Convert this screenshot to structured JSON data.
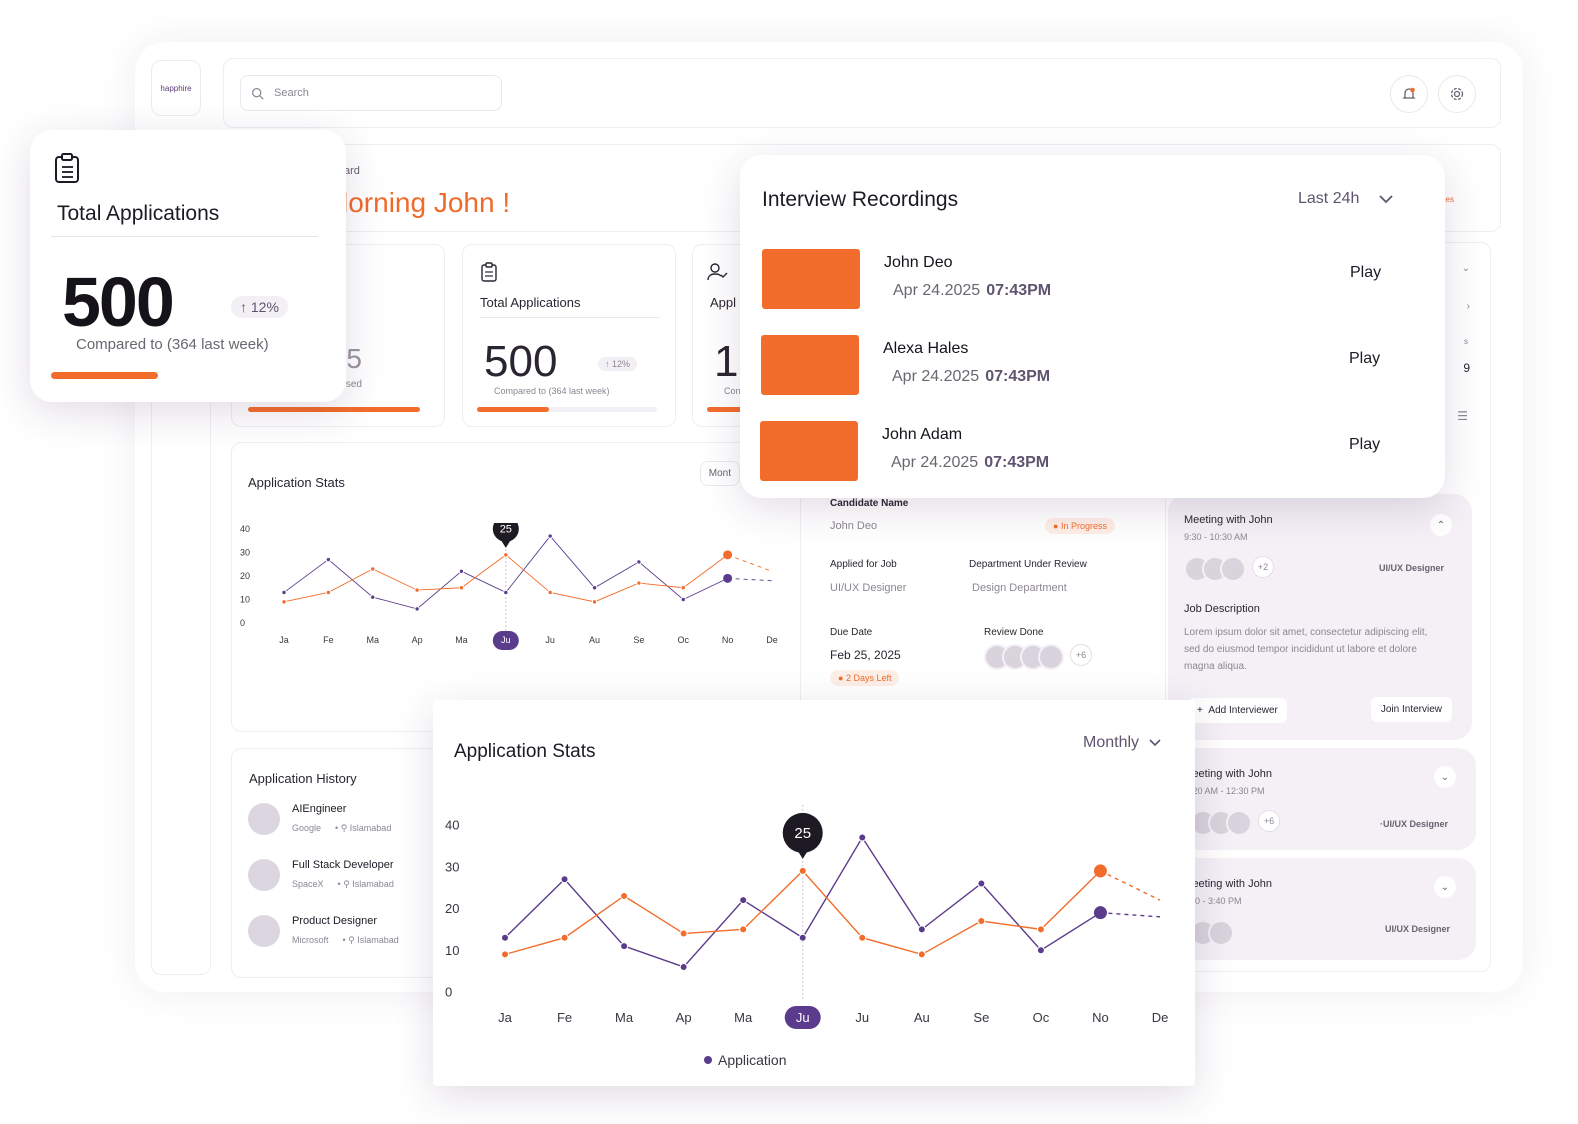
{
  "brand": {
    "logo": "happhire",
    "accent": "#f26d2b",
    "purple": "#5a3b8c"
  },
  "topbar": {
    "search_placeholder": "Search",
    "bell_icon": "bell-icon",
    "settings_icon": "gear-icon"
  },
  "greeting": {
    "breadcrumb": "ard",
    "message": "lorning John !",
    "right_text": "es"
  },
  "stat_cards": [
    {
      "label": "",
      "value": "5",
      "note": "sed"
    },
    {
      "label": "Total Applications",
      "value": "500",
      "change": "12%",
      "note": "Compared to (364 last week)",
      "progress": 0.4
    },
    {
      "label": "Appl",
      "value": "15",
      "note": "Con"
    }
  ],
  "total_card": {
    "title": "Total Applications",
    "value": "500",
    "change": "12%",
    "note": "Compared to (364 last week)",
    "progress": 0.4
  },
  "interview_recordings": {
    "title": "Interview Recordings",
    "filter": "Last 24h",
    "items": [
      {
        "name": "John Deo",
        "date": "Apr 24.2025",
        "time": "07:43PM",
        "action": "Play"
      },
      {
        "name": "Alexa Hales",
        "date": "Apr 24.2025",
        "time": "07:43PM",
        "action": "Play"
      },
      {
        "name": "John Adam",
        "date": "Apr 24.2025",
        "time": "07:43PM",
        "action": "Play"
      }
    ]
  },
  "bg_stats": {
    "title": "Application Stats",
    "filter": "Mont"
  },
  "candidate": {
    "name_label": "Candidate Name",
    "name": "John Deo",
    "status": "In Progress",
    "job_label": "Applied for Job",
    "job": "UI/UX Designer",
    "dept_label": "Department Under Review",
    "dept": "Design Department",
    "due_label": "Due Date",
    "due": "Feb 25, 2025",
    "due_badge": "2 Days Left",
    "review_label": "Review Done",
    "review_more": "+6"
  },
  "right_panel": {
    "num": "9",
    "small": "s"
  },
  "meetings": [
    {
      "title": "Meeting with John",
      "time": "9:30 - 10:30 AM",
      "more": "+2",
      "role": "UI/UX Designer",
      "desc_label": "Job Description",
      "desc": "Lorem ipsum dolor sit amet, consectetur adipiscing elit, sed do eiusmod tempor incididunt ut labore et dolore magna aliqua.",
      "add_btn": "Add Interviewer",
      "join_btn": "Join Interview"
    },
    {
      "title": "leeting with John",
      "time": ":20 AM - 12:30 PM",
      "more": "+6",
      "role": "·UI/UX Designer"
    },
    {
      "title": "leeting with John",
      "time": "00 - 3:40 PM",
      "role": "UI/UX Designer"
    }
  ],
  "history": {
    "title": "Application History",
    "items": [
      {
        "role": "AIEngineer",
        "company": "Google",
        "location": "Islamabad"
      },
      {
        "role": "Full Stack Developer",
        "company": "SpaceX",
        "location": "Islamabad"
      },
      {
        "role": "Product Designer",
        "company": "Microsoft",
        "location": "Islamabad"
      }
    ]
  },
  "stats_card": {
    "title": "Application Stats",
    "filter": "Monthly"
  },
  "chart_data": [
    {
      "type": "line",
      "title": "Application Stats",
      "categories": [
        "Ja",
        "Fe",
        "Ma",
        "Ap",
        "Ma",
        "Ju",
        "Ju",
        "Au",
        "Se",
        "Oc",
        "No",
        "De"
      ],
      "highlight_index": 5,
      "tooltip": "25",
      "ylim": [
        0,
        40
      ],
      "yticks": [
        0,
        10,
        20,
        30,
        40
      ],
      "legend": [
        "Application"
      ],
      "series": [
        {
          "name": "Application",
          "color": "#5a3b8c",
          "values": [
            13,
            27,
            11,
            6,
            22,
            13,
            37,
            15,
            26,
            10,
            19,
            null
          ],
          "projection": 18
        },
        {
          "color": "#f26d2b",
          "values": [
            9,
            13,
            23,
            14,
            15,
            29,
            13,
            9,
            17,
            15,
            29,
            null
          ],
          "projection": 22
        }
      ]
    },
    {
      "type": "line",
      "title": "Application Stats",
      "categories": [
        "Ja",
        "Fe",
        "Ma",
        "Ap",
        "Ma",
        "Ju",
        "Ju",
        "Au",
        "Se",
        "Oc",
        "No",
        "De"
      ],
      "highlight_index": 5,
      "tooltip": "25",
      "ylim": [
        0,
        40
      ],
      "yticks": [
        0,
        10,
        20,
        30,
        40
      ],
      "series": [
        {
          "color": "#5a3b8c",
          "values": [
            13,
            27,
            11,
            6,
            22,
            13,
            37,
            15,
            26,
            10,
            19,
            null
          ],
          "projection": 18
        },
        {
          "color": "#f26d2b",
          "values": [
            9,
            13,
            23,
            14,
            15,
            29,
            13,
            9,
            17,
            15,
            29,
            null
          ],
          "projection": 22
        }
      ]
    }
  ]
}
